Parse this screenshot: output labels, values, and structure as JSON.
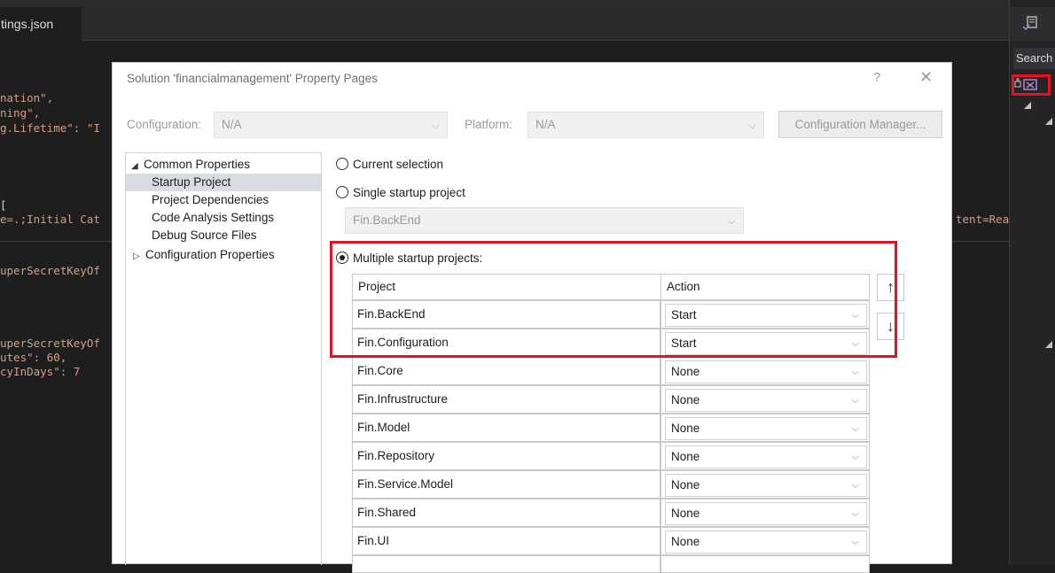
{
  "editor": {
    "tab_label": "tings.json",
    "code_lines": [
      {
        "text": "nation\","
      },
      {
        "text": "ning\","
      },
      {
        "text": "g.Lifetime\": \"I"
      },
      {
        "text": "["
      },
      {
        "text": "e=.;Initial Cat"
      },
      {
        "text": "uperSecretKeyOf"
      },
      {
        "text": "uperSecretKeyOf"
      },
      {
        "text": "utes\": 60,"
      },
      {
        "text": "cyInDays\": 7"
      }
    ],
    "code_right_fragment": "tent=Rea"
  },
  "right_panel": {
    "search_label": "Search"
  },
  "dialog": {
    "title": "Solution 'financialmanagement' Property Pages",
    "help_label": "?",
    "close_label": "✕",
    "configuration_label": "Configuration:",
    "configuration_value": "N/A",
    "platform_label": "Platform:",
    "platform_value": "N/A",
    "configuration_manager_label": "Configuration Manager...",
    "tree": {
      "common_properties": "Common Properties",
      "startup_project": "Startup Project",
      "project_dependencies": "Project Dependencies",
      "code_analysis_settings": "Code Analysis Settings",
      "debug_source_files": "Debug Source Files",
      "configuration_properties": "Configuration Properties"
    },
    "options": {
      "current_selection": "Current selection",
      "single_startup": "Single startup project",
      "single_value": "Fin.BackEnd",
      "multiple_startup": "Multiple startup projects:"
    },
    "grid": {
      "header_project": "Project",
      "header_action": "Action",
      "rows": [
        {
          "project": "Fin.BackEnd",
          "action": "Start"
        },
        {
          "project": "Fin.Configuration",
          "action": "Start"
        },
        {
          "project": "Fin.Core",
          "action": "None"
        },
        {
          "project": "Fin.Infrustructure",
          "action": "None"
        },
        {
          "project": "Fin.Model",
          "action": "None"
        },
        {
          "project": "Fin.Repository",
          "action": "None"
        },
        {
          "project": "Fin.Service.Model",
          "action": "None"
        },
        {
          "project": "Fin.Shared",
          "action": "None"
        },
        {
          "project": "Fin.UI",
          "action": "None"
        }
      ]
    },
    "move_up_label": "↑",
    "move_down_label": "↓"
  },
  "colors": {
    "highlight": "#e81123",
    "editor_bg": "#1e1e1e",
    "selected_bg": "#d9dbe3"
  }
}
